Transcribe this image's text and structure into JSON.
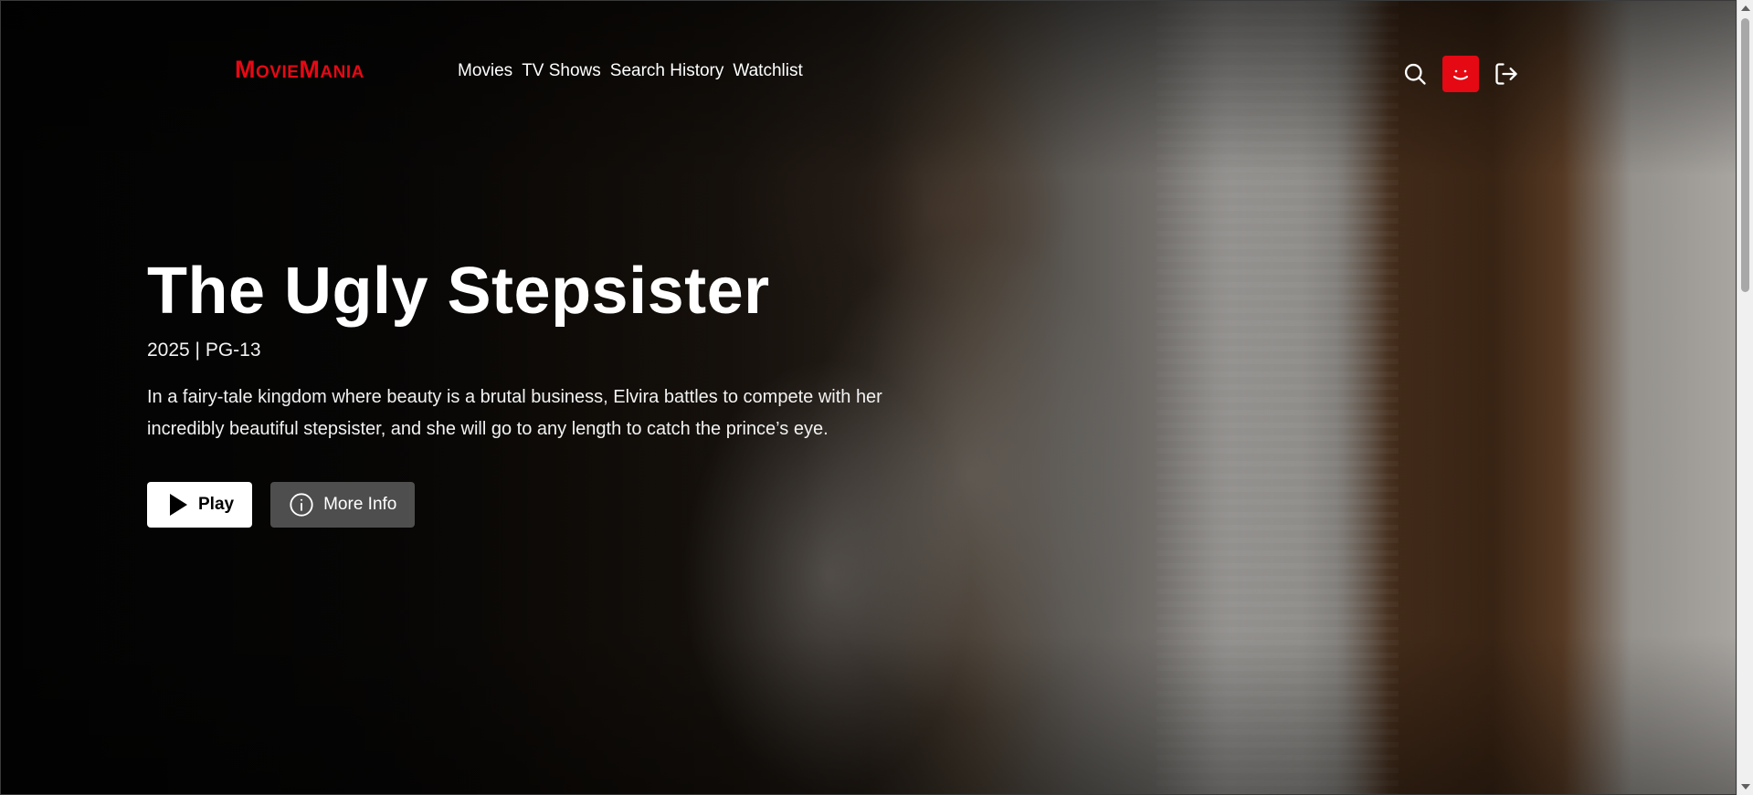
{
  "app": {
    "logo_text": "MovieMania",
    "brand_color": "#e50914"
  },
  "nav": {
    "links": [
      {
        "label": "Movies"
      },
      {
        "label": "TV Shows"
      },
      {
        "label": "Search History"
      },
      {
        "label": "Watchlist"
      }
    ],
    "icons": [
      "search-icon",
      "avatar-smile-icon",
      "logout-icon"
    ]
  },
  "hero": {
    "title": "The Ugly Stepsister",
    "meta": "2025 | PG-13",
    "description": "In a fairy-tale kingdom where beauty is a brutal business, Elvira battles to compete with her incredibly beautiful stepsister, and she will go to any length to catch the prince’s eye.",
    "play_label": "Play",
    "info_label": "More Info"
  }
}
